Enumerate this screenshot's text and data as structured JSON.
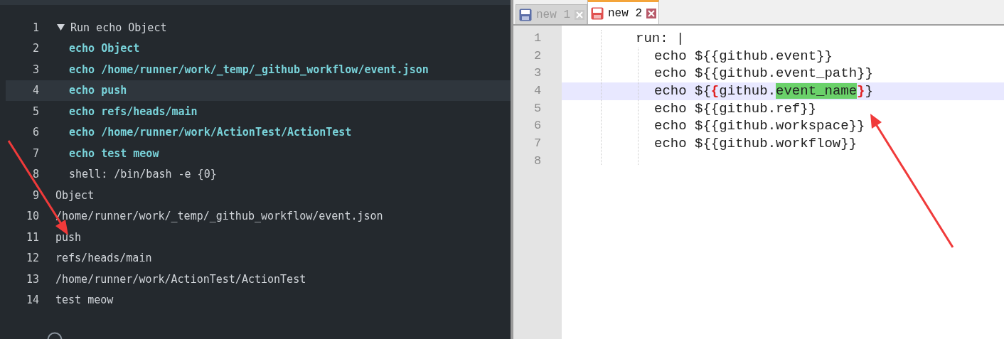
{
  "log_panel": {
    "lines": [
      {
        "number": "1",
        "text": "Run echo Object",
        "kind": "step_header",
        "expanded": true,
        "highlighted": false
      },
      {
        "number": "2",
        "text": "echo Object",
        "kind": "command",
        "highlighted": false
      },
      {
        "number": "3",
        "text": "echo /home/runner/work/_temp/_github_workflow/event.json",
        "kind": "command",
        "highlighted": false
      },
      {
        "number": "4",
        "text": "echo push",
        "kind": "command",
        "highlighted": true
      },
      {
        "number": "5",
        "text": "echo refs/heads/main",
        "kind": "command",
        "highlighted": false
      },
      {
        "number": "6",
        "text": "echo /home/runner/work/ActionTest/ActionTest",
        "kind": "command",
        "highlighted": false
      },
      {
        "number": "7",
        "text": "echo test meow",
        "kind": "command",
        "highlighted": false
      },
      {
        "number": "8",
        "text": "shell: /bin/bash -e {0}",
        "kind": "param",
        "highlighted": false
      },
      {
        "number": "9",
        "text": "Object",
        "kind": "output",
        "highlighted": false
      },
      {
        "number": "10",
        "text": "/home/runner/work/_temp/_github_workflow/event.json",
        "kind": "output",
        "highlighted": false
      },
      {
        "number": "11",
        "text": "push",
        "kind": "output",
        "highlighted": false
      },
      {
        "number": "12",
        "text": "refs/heads/main",
        "kind": "output",
        "highlighted": false
      },
      {
        "number": "13",
        "text": "/home/runner/work/ActionTest/ActionTest",
        "kind": "output",
        "highlighted": false
      },
      {
        "number": "14",
        "text": "test meow",
        "kind": "output",
        "highlighted": false
      }
    ]
  },
  "editor": {
    "tabs": [
      {
        "label": "new 1",
        "selected": false
      },
      {
        "label": "new 2",
        "selected": true
      }
    ],
    "lines": [
      {
        "number": "1",
        "current": false,
        "kind": "key",
        "segments": [
          {
            "text": "run: |",
            "kind": "plain"
          }
        ]
      },
      {
        "number": "2",
        "current": false,
        "kind": "item",
        "segments": [
          {
            "text": "echo ${{github.event}}",
            "kind": "plain"
          }
        ]
      },
      {
        "number": "3",
        "current": false,
        "kind": "item",
        "segments": [
          {
            "text": "echo ${{github.event_path}}",
            "kind": "plain"
          }
        ]
      },
      {
        "number": "4",
        "current": true,
        "kind": "item",
        "segments": [
          {
            "text": "echo ${",
            "kind": "plain"
          },
          {
            "text": "{",
            "kind": "brace_match"
          },
          {
            "text": "github.",
            "kind": "plain"
          },
          {
            "text": "event_name",
            "kind": "selected"
          },
          {
            "text": "}",
            "kind": "brace_match"
          },
          {
            "text": "}",
            "kind": "plain"
          }
        ]
      },
      {
        "number": "5",
        "current": false,
        "kind": "item",
        "segments": [
          {
            "text": "echo ${{github.ref}}",
            "kind": "plain"
          }
        ]
      },
      {
        "number": "6",
        "current": false,
        "kind": "item",
        "segments": [
          {
            "text": "echo ${{github.workspace}}",
            "kind": "plain"
          }
        ]
      },
      {
        "number": "7",
        "current": false,
        "kind": "item",
        "segments": [
          {
            "text": "echo ${{github.workflow}}",
            "kind": "plain"
          }
        ]
      },
      {
        "number": "8",
        "current": false,
        "kind": "blank"
      }
    ]
  }
}
